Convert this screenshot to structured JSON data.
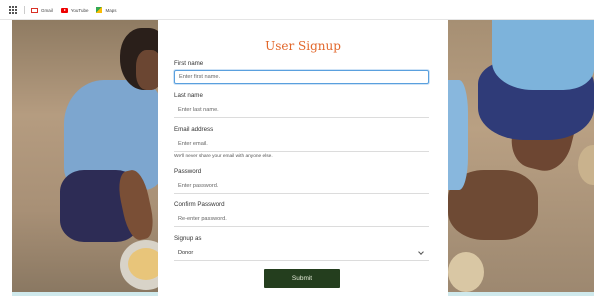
{
  "bookmarks": {
    "items": [
      {
        "label": "Gmail",
        "icon": "gmail-icon"
      },
      {
        "label": "YouTube",
        "icon": "youtube-icon"
      },
      {
        "label": "Maps",
        "icon": "maps-icon"
      }
    ]
  },
  "form": {
    "title": "User Signup",
    "first_name": {
      "label": "First name",
      "placeholder": "Enter first name."
    },
    "last_name": {
      "label": "Last name",
      "placeholder": "Enter last name."
    },
    "email": {
      "label": "Email address",
      "placeholder": "Enter email.",
      "help": "We'll never share your email with anyone else."
    },
    "password": {
      "label": "Password",
      "placeholder": "Enter password."
    },
    "confirm_password": {
      "label": "Confirm Password",
      "placeholder": "Re-enter password."
    },
    "signup_as": {
      "label": "Signup as",
      "value": "Donor"
    },
    "submit_label": "Submit"
  },
  "colors": {
    "title": "#e2672b",
    "submit_bg": "#243e1e",
    "focus_border": "#5aa0de"
  }
}
